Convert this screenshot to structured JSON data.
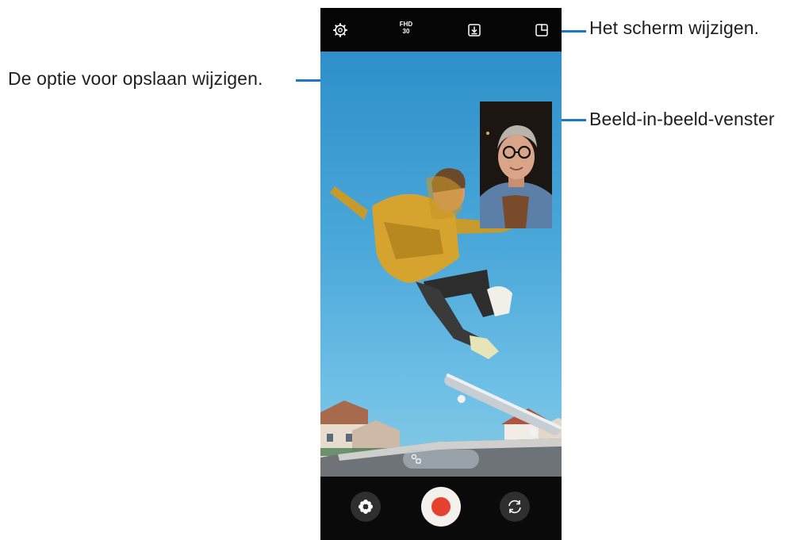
{
  "annotations": {
    "change_screen": "Het scherm wijzigen.",
    "save_option": "De optie voor opslaan wijzigen.",
    "pip_window": "Beeld-in-beeld-venster"
  },
  "camera": {
    "resolution": "FHD",
    "fps": "30"
  },
  "colors": {
    "leader": "#1a77c9",
    "record": "#e5412f"
  },
  "icons": [
    "settings-icon",
    "save-option-icon",
    "screen-layout-icon",
    "mode-icon",
    "chevron-left-icon",
    "effects-icon",
    "record-icon",
    "switch-camera-icon"
  ]
}
